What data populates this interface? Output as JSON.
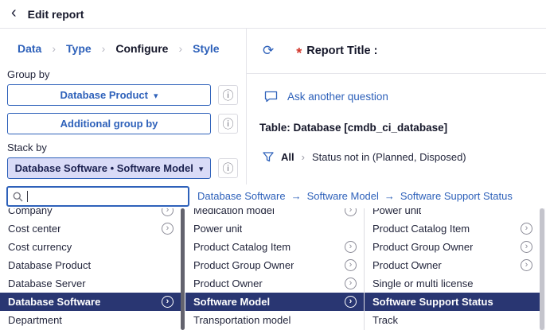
{
  "colors": {
    "accent": "#2e61ba",
    "selected_bg": "#293672",
    "stacked_bg": "#d9dbf7",
    "required": "#d2372c"
  },
  "icons": {
    "back": "‹",
    "caret_down": "▾",
    "info": "ⓘ",
    "refresh": "⟳",
    "asterisk": "*",
    "chevron_right": "›",
    "arrow_right": "→"
  },
  "header": {
    "title": "Edit report"
  },
  "tabs": {
    "items": [
      {
        "label": "Data",
        "active": false
      },
      {
        "label": "Type",
        "active": false
      },
      {
        "label": "Configure",
        "active": true
      },
      {
        "label": "Style",
        "active": false
      }
    ]
  },
  "left_panel": {
    "group_by_label": "Group by",
    "group_by_value": "Database Product",
    "additional_group_by_label": "Additional group by",
    "stack_by_label": "Stack by",
    "stack_by_value": "Database Software • Software Model"
  },
  "right_panel": {
    "report_title_label": "Report Title :",
    "ask_another_question": "Ask another question",
    "table_info": "Table: Database [cmdb_ci_database]",
    "filter_scope": "All",
    "filter_condition": "Status not in (Planned, Disposed)"
  },
  "picker": {
    "search_value": "",
    "search_placeholder": "",
    "breadcrumb": {
      "items": [
        "Database Software",
        "Software Model",
        "Software Support Status"
      ]
    },
    "columns": [
      {
        "items": [
          {
            "label": "Company",
            "expandable": true,
            "selected": false
          },
          {
            "label": "Cost center",
            "expandable": true,
            "selected": false
          },
          {
            "label": "Cost currency",
            "expandable": false,
            "selected": false
          },
          {
            "label": "Database Product",
            "expandable": false,
            "selected": false
          },
          {
            "label": "Database Server",
            "expandable": false,
            "selected": false
          },
          {
            "label": "Database Software",
            "expandable": true,
            "selected": true
          },
          {
            "label": "Department",
            "expandable": false,
            "selected": false
          }
        ]
      },
      {
        "items": [
          {
            "label": "Medication model",
            "expandable": true,
            "selected": false
          },
          {
            "label": "Power unit",
            "expandable": false,
            "selected": false
          },
          {
            "label": "Product Catalog Item",
            "expandable": true,
            "selected": false
          },
          {
            "label": "Product Group Owner",
            "expandable": true,
            "selected": false
          },
          {
            "label": "Product Owner",
            "expandable": true,
            "selected": false
          },
          {
            "label": "Software Model",
            "expandable": true,
            "selected": true
          },
          {
            "label": "Transportation model",
            "expandable": false,
            "selected": false
          }
        ]
      },
      {
        "items": [
          {
            "label": "Power unit",
            "expandable": false,
            "selected": false
          },
          {
            "label": "Product Catalog Item",
            "expandable": true,
            "selected": false
          },
          {
            "label": "Product Group Owner",
            "expandable": true,
            "selected": false
          },
          {
            "label": "Product Owner",
            "expandable": true,
            "selected": false
          },
          {
            "label": "Single or multi license",
            "expandable": false,
            "selected": false
          },
          {
            "label": "Software Support Status",
            "expandable": false,
            "selected": true
          },
          {
            "label": "Track",
            "expandable": false,
            "selected": false
          }
        ]
      }
    ]
  }
}
